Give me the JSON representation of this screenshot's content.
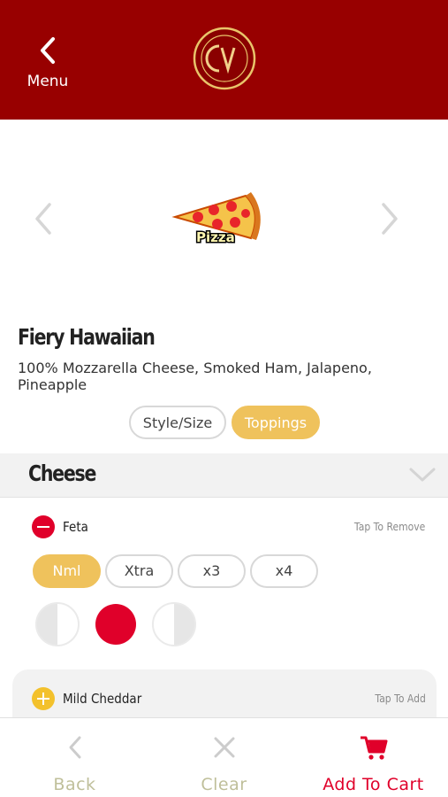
{
  "header": {
    "back_label": "Menu",
    "background_color": "#980000",
    "logo": {
      "icon": "cv-logo"
    }
  },
  "carousel": {
    "prev_icon": "chevron-left-icon",
    "next_icon": "chevron-right-icon",
    "image": {
      "icon": "pizza-slice-icon",
      "caption": "Pizza"
    }
  },
  "product": {
    "title": "Fiery Hawaiian",
    "description": "100% Mozzarella Cheese, Smoked Ham, Jalapeno, Pineapple"
  },
  "tabs": [
    {
      "label": "Style/Size",
      "active": false
    },
    {
      "label": "Toppings",
      "active": true
    }
  ],
  "section": {
    "title": "Cheese",
    "chevron_icon": "chevron-down-icon"
  },
  "toppings": [
    {
      "name": "Feta",
      "action": "Tap To Remove",
      "selected": true,
      "amounts": [
        "Nml",
        "Xtra",
        "x3",
        "x4"
      ],
      "selected_amount": "Nml",
      "placements": [
        "left-half",
        "whole",
        "right-half"
      ],
      "selected_placement": "whole"
    },
    {
      "name": "Mild Cheddar",
      "action": "Tap To Add",
      "selected": false
    }
  ],
  "bottom_bar": {
    "back_label": "Back",
    "clear_label": "Clear",
    "cart_label": "Add To Cart"
  },
  "colors": {
    "brand_red": "#980000",
    "accent_red": "#e0002a",
    "accent_gold": "#efc25c",
    "muted_label": "#bfbf9a"
  }
}
